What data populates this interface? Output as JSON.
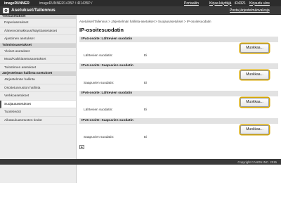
{
  "header": {
    "brand": "imageRUNNER",
    "model": "imageRUNNER1435P / iR1435P /",
    "portal_link": "Portaaliin",
    "logout_link": "Kirjaa käyttäjä",
    "user": "iR4321",
    "logout2_link": "Kirjaudu ulos"
  },
  "titlebar": {
    "title": "Asetukset/Tallennus",
    "icon": "settings-gear-icon",
    "portal_button": "Posta järjestelmänvalvoja"
  },
  "sidebar": {
    "sections": [
      {
        "heading": "Yleisasetukset",
        "items": [
          "Paperiasetukset",
          "Äänenvoimakkuus/Näyttöasetukset",
          "Ajastimen asetukset"
        ]
      },
      {
        "heading": "Toimintoasetukset",
        "items": [
          "Yleiset asetukset",
          "Muut/Kaikkiasetusasetukset",
          "Tulostimen asetukset"
        ]
      },
      {
        "heading": "Järjestelmän hallinta-asetukset",
        "items": [
          "Järjestelmän hallinta",
          "Osoitetunnuston hallinta",
          "Verkkoasetukset",
          "Suojausasetukset",
          "Tuotetiedot",
          "Aikatauluasetusten tiedot"
        ]
      }
    ],
    "active_item": "Suojausasetukset"
  },
  "main": {
    "breadcrumb": "Asetukset/Tallennus > Järjestelmän hallinta-asetukset > Suojausasetukset > IP-osoitesuodatin",
    "title": "IP-osoitesuodatin",
    "panels": [
      {
        "header": "IPv4-osoite: Lähtevien suodatin",
        "label": "Lähtevien suodatin:",
        "value": "Ei",
        "button": "Muokkaa..."
      },
      {
        "header": "IPv4-osoite: Saapuvien suodatin",
        "label": "Saapuvien suodatin:",
        "value": "Ei",
        "button": "Muokkaa..."
      },
      {
        "header": "IPv6-osoite: Lähtevien suodatin",
        "label": "Lähtevien suodatin:",
        "value": "Ei",
        "button": "Muokkaa..."
      },
      {
        "header": "IPv6-osoite: Saapuvien suodatin",
        "label": "Saapuvien suodatin:",
        "value": "Ei",
        "button": "Muokkaa..."
      }
    ],
    "top_icon": "back-to-top-icon"
  },
  "footer": {
    "copyright": "Copyright CANON INC. 2015"
  },
  "colors": {
    "header_bg": "#2c2c2c",
    "titlebar_bg": "#3a3a3a",
    "sidebar_bg": "#ececec",
    "panel_header_bg": "#e2e2e2",
    "button_highlight": "#d9a800"
  }
}
